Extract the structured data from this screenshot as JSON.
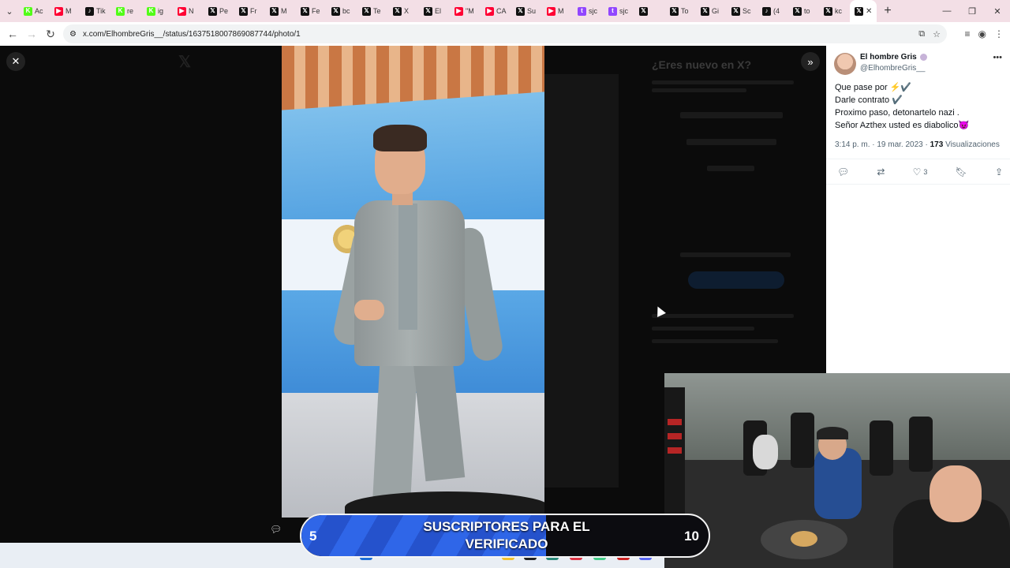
{
  "browser": {
    "tabs": [
      {
        "label": "Ac",
        "icon": "kick-icon",
        "color": "#53fc18"
      },
      {
        "label": "M",
        "icon": "youtube-icon",
        "color": "#ff0033"
      },
      {
        "label": "Tik",
        "icon": "tiktok-icon",
        "color": "#111111"
      },
      {
        "label": "re",
        "icon": "kick-icon",
        "color": "#53fc18"
      },
      {
        "label": "ig",
        "icon": "kick-icon",
        "color": "#53fc18"
      },
      {
        "label": "N",
        "icon": "youtube-icon",
        "color": "#ff0033"
      },
      {
        "label": "Pe",
        "icon": "x-icon",
        "color": "#111111"
      },
      {
        "label": "Fr",
        "icon": "x-icon",
        "color": "#111111"
      },
      {
        "label": "M",
        "icon": "x-icon",
        "color": "#111111"
      },
      {
        "label": "Fe",
        "icon": "x-icon",
        "color": "#111111"
      },
      {
        "label": "bc",
        "icon": "x-icon",
        "color": "#111111"
      },
      {
        "label": "Te",
        "icon": "x-icon",
        "color": "#111111"
      },
      {
        "label": "X",
        "icon": "x-icon",
        "color": "#111111"
      },
      {
        "label": "El",
        "icon": "x-icon",
        "color": "#111111"
      },
      {
        "label": "\"M",
        "icon": "youtube-icon",
        "color": "#ff0033"
      },
      {
        "label": "CA",
        "icon": "youtube-icon",
        "color": "#ff0033"
      },
      {
        "label": "Su",
        "icon": "x-icon",
        "color": "#111111"
      },
      {
        "label": "M",
        "icon": "youtube-icon",
        "color": "#ff0033"
      },
      {
        "label": "sjc",
        "icon": "twitch-icon",
        "color": "#9146ff"
      },
      {
        "label": "sjc",
        "icon": "twitch-icon",
        "color": "#9146ff"
      },
      {
        "label": "",
        "icon": "x-icon",
        "color": "#111111"
      },
      {
        "label": "To",
        "icon": "x-icon",
        "color": "#111111"
      },
      {
        "label": "Gi",
        "icon": "x-icon",
        "color": "#111111"
      },
      {
        "label": "Sc",
        "icon": "x-icon",
        "color": "#111111"
      },
      {
        "label": "(4",
        "icon": "tiktok-icon",
        "color": "#111111"
      },
      {
        "label": "to",
        "icon": "x-icon",
        "color": "#111111"
      },
      {
        "label": "kc",
        "icon": "x-icon",
        "color": "#111111"
      }
    ],
    "active_tab_icon": "x-icon",
    "url": "x.com/ElhombreGris__/status/1637518007869087744/photo/1"
  },
  "background_page": {
    "heading": "¿Eres nuevo en X?"
  },
  "tweet": {
    "author_name": "El hombre Gris",
    "author_handle": "@ElhombreGris__",
    "lines": [
      "Que pase por ⚡✔️",
      "Darle contrato ✔️",
      "Proximo paso, detonartelo nazi .",
      "Señor Azthex usted es diabolico😈"
    ],
    "time": "3:14 p. m. · 19 mar. 2023 · ",
    "views_count": "173",
    "views_label": " Visualizaciones",
    "likes": "3"
  },
  "overlay": {
    "start": "5",
    "goal": "10",
    "title": "SUSCRIPTORES PARA EL VERIFICADO",
    "progress": 0.6
  },
  "colors": {
    "tab_bar": "#f3dfe6",
    "sub_fill": "#2f66e8",
    "x_blue": "#1d9bf0"
  }
}
